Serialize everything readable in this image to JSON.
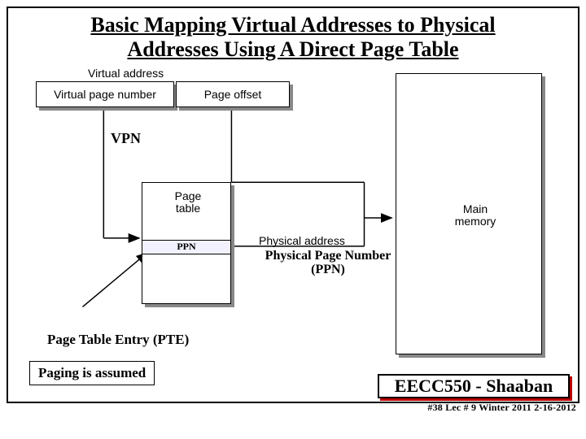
{
  "title_line1": "Basic Mapping Virtual Addresses to Physical",
  "title_line2": "Addresses Using A Direct Page Table",
  "virtual_address": "Virtual address",
  "vpn_box": "Virtual page number",
  "page_offset": "Page offset",
  "vpn_label": "VPN",
  "page_table": "Page table",
  "ppn_row": "PPN",
  "physical_address": "Physical address",
  "ppn_caption_l1": "Physical Page Number",
  "ppn_caption_l2": "(PPN)",
  "main_memory": "Main memory",
  "pte_label": "Page Table Entry (PTE)",
  "paging_assumed": "Paging is assumed",
  "footer_course": "EECC550 - Shaaban",
  "footer_meta": "#38  Lec # 9  Winter 2011  2-16-2012"
}
